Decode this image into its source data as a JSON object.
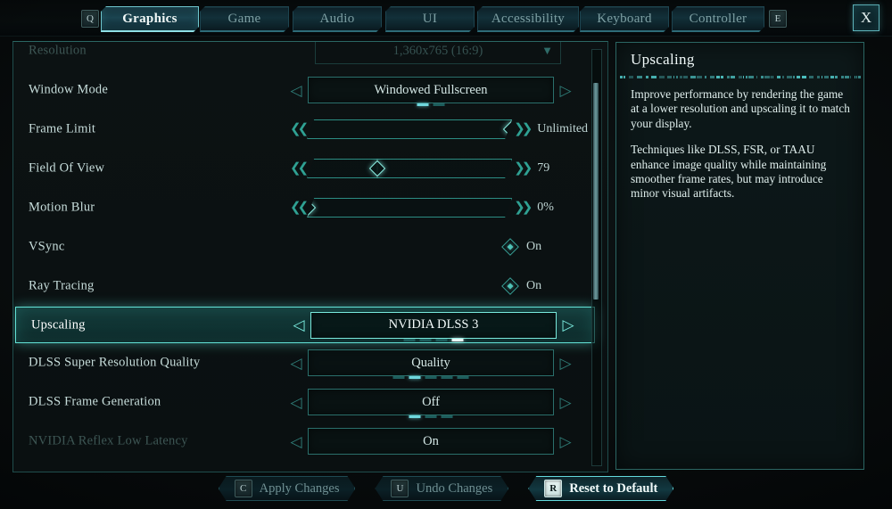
{
  "header": {
    "left_key": "Q",
    "right_key": "E",
    "close_label": "X",
    "tabs": [
      {
        "label": "Graphics",
        "active": true
      },
      {
        "label": "Game",
        "active": false
      },
      {
        "label": "Audio",
        "active": false
      },
      {
        "label": "UI",
        "active": false
      },
      {
        "label": "Accessibility",
        "active": false
      },
      {
        "label": "Keyboard",
        "active": false
      },
      {
        "label": "Controller",
        "active": false
      }
    ]
  },
  "settings": [
    {
      "label": "Resolution",
      "type": "dropdown",
      "value": "1,360x765 (16:9)",
      "dimmed": true,
      "caret": "▼"
    },
    {
      "label": "Window Mode",
      "type": "select",
      "value": "Windowed Fullscreen",
      "pips": 2,
      "pip_active": 0
    },
    {
      "label": "Frame Limit",
      "type": "slider",
      "value": "Unlimited",
      "fill_pct": 100
    },
    {
      "label": "Field Of View",
      "type": "slider",
      "value": "79",
      "fill_pct": 34
    },
    {
      "label": "Motion Blur",
      "type": "slider",
      "value": "0%",
      "fill_pct": 0
    },
    {
      "label": "VSync",
      "type": "checkbox",
      "value": "On"
    },
    {
      "label": "Ray Tracing",
      "type": "checkbox",
      "value": "On"
    },
    {
      "label": "Upscaling",
      "type": "select",
      "value": "NVIDIA DLSS 3",
      "pips": 4,
      "pip_active": 3,
      "selected": true
    },
    {
      "label": "DLSS Super Resolution Quality",
      "type": "select",
      "value": "Quality",
      "pips": 5,
      "pip_active": 1
    },
    {
      "label": "DLSS Frame Generation",
      "type": "select",
      "value": "Off",
      "pips": 3,
      "pip_active": 0
    },
    {
      "label": "NVIDIA Reflex Low Latency",
      "type": "select",
      "value": "On",
      "pips": 0,
      "pip_active": -1,
      "dimmed": true
    }
  ],
  "info": {
    "title": "Upscaling",
    "paragraphs": [
      "Improve performance by rendering the game at a lower resolution and upscaling it to match your display.",
      "Techniques like DLSS, FSR, or TAAU enhance image quality while maintaining smoother frame rates, but may introduce minor visual artifacts."
    ]
  },
  "actions": [
    {
      "key": "C",
      "label": "Apply Changes",
      "active": false
    },
    {
      "key": "U",
      "label": "Undo Changes",
      "active": false
    },
    {
      "key": "R",
      "label": "Reset to Default",
      "active": true
    }
  ],
  "scrollbar": {
    "thumb_top_pct": 8,
    "thumb_height_pct": 52
  },
  "colors": {
    "accent": "#63e2d6",
    "teal_border": "#2b6663",
    "text": "#cfe3e2",
    "bg": "#0a1011"
  }
}
